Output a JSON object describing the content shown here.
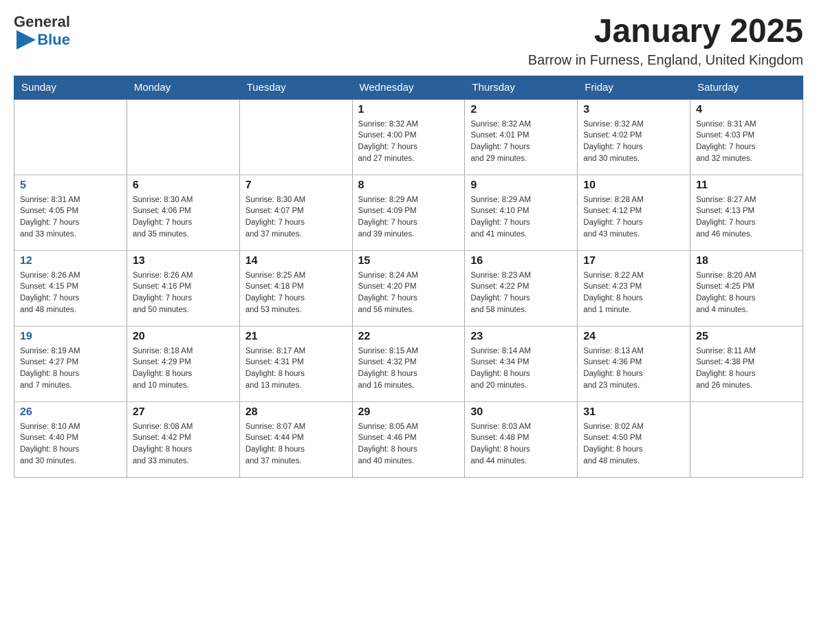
{
  "header": {
    "logo": {
      "general": "General",
      "triangle_icon": "▶",
      "blue": "Blue"
    },
    "title": "January 2025",
    "location": "Barrow in Furness, England, United Kingdom"
  },
  "days_of_week": [
    "Sunday",
    "Monday",
    "Tuesday",
    "Wednesday",
    "Thursday",
    "Friday",
    "Saturday"
  ],
  "weeks": [
    [
      {
        "day": "",
        "info": ""
      },
      {
        "day": "",
        "info": ""
      },
      {
        "day": "",
        "info": ""
      },
      {
        "day": "1",
        "info": "Sunrise: 8:32 AM\nSunset: 4:00 PM\nDaylight: 7 hours\nand 27 minutes."
      },
      {
        "day": "2",
        "info": "Sunrise: 8:32 AM\nSunset: 4:01 PM\nDaylight: 7 hours\nand 29 minutes."
      },
      {
        "day": "3",
        "info": "Sunrise: 8:32 AM\nSunset: 4:02 PM\nDaylight: 7 hours\nand 30 minutes."
      },
      {
        "day": "4",
        "info": "Sunrise: 8:31 AM\nSunset: 4:03 PM\nDaylight: 7 hours\nand 32 minutes."
      }
    ],
    [
      {
        "day": "5",
        "info": "Sunrise: 8:31 AM\nSunset: 4:05 PM\nDaylight: 7 hours\nand 33 minutes."
      },
      {
        "day": "6",
        "info": "Sunrise: 8:30 AM\nSunset: 4:06 PM\nDaylight: 7 hours\nand 35 minutes."
      },
      {
        "day": "7",
        "info": "Sunrise: 8:30 AM\nSunset: 4:07 PM\nDaylight: 7 hours\nand 37 minutes."
      },
      {
        "day": "8",
        "info": "Sunrise: 8:29 AM\nSunset: 4:09 PM\nDaylight: 7 hours\nand 39 minutes."
      },
      {
        "day": "9",
        "info": "Sunrise: 8:29 AM\nSunset: 4:10 PM\nDaylight: 7 hours\nand 41 minutes."
      },
      {
        "day": "10",
        "info": "Sunrise: 8:28 AM\nSunset: 4:12 PM\nDaylight: 7 hours\nand 43 minutes."
      },
      {
        "day": "11",
        "info": "Sunrise: 8:27 AM\nSunset: 4:13 PM\nDaylight: 7 hours\nand 46 minutes."
      }
    ],
    [
      {
        "day": "12",
        "info": "Sunrise: 8:26 AM\nSunset: 4:15 PM\nDaylight: 7 hours\nand 48 minutes."
      },
      {
        "day": "13",
        "info": "Sunrise: 8:26 AM\nSunset: 4:16 PM\nDaylight: 7 hours\nand 50 minutes."
      },
      {
        "day": "14",
        "info": "Sunrise: 8:25 AM\nSunset: 4:18 PM\nDaylight: 7 hours\nand 53 minutes."
      },
      {
        "day": "15",
        "info": "Sunrise: 8:24 AM\nSunset: 4:20 PM\nDaylight: 7 hours\nand 56 minutes."
      },
      {
        "day": "16",
        "info": "Sunrise: 8:23 AM\nSunset: 4:22 PM\nDaylight: 7 hours\nand 58 minutes."
      },
      {
        "day": "17",
        "info": "Sunrise: 8:22 AM\nSunset: 4:23 PM\nDaylight: 8 hours\nand 1 minute."
      },
      {
        "day": "18",
        "info": "Sunrise: 8:20 AM\nSunset: 4:25 PM\nDaylight: 8 hours\nand 4 minutes."
      }
    ],
    [
      {
        "day": "19",
        "info": "Sunrise: 8:19 AM\nSunset: 4:27 PM\nDaylight: 8 hours\nand 7 minutes."
      },
      {
        "day": "20",
        "info": "Sunrise: 8:18 AM\nSunset: 4:29 PM\nDaylight: 8 hours\nand 10 minutes."
      },
      {
        "day": "21",
        "info": "Sunrise: 8:17 AM\nSunset: 4:31 PM\nDaylight: 8 hours\nand 13 minutes."
      },
      {
        "day": "22",
        "info": "Sunrise: 8:15 AM\nSunset: 4:32 PM\nDaylight: 8 hours\nand 16 minutes."
      },
      {
        "day": "23",
        "info": "Sunrise: 8:14 AM\nSunset: 4:34 PM\nDaylight: 8 hours\nand 20 minutes."
      },
      {
        "day": "24",
        "info": "Sunrise: 8:13 AM\nSunset: 4:36 PM\nDaylight: 8 hours\nand 23 minutes."
      },
      {
        "day": "25",
        "info": "Sunrise: 8:11 AM\nSunset: 4:38 PM\nDaylight: 8 hours\nand 26 minutes."
      }
    ],
    [
      {
        "day": "26",
        "info": "Sunrise: 8:10 AM\nSunset: 4:40 PM\nDaylight: 8 hours\nand 30 minutes."
      },
      {
        "day": "27",
        "info": "Sunrise: 8:08 AM\nSunset: 4:42 PM\nDaylight: 8 hours\nand 33 minutes."
      },
      {
        "day": "28",
        "info": "Sunrise: 8:07 AM\nSunset: 4:44 PM\nDaylight: 8 hours\nand 37 minutes."
      },
      {
        "day": "29",
        "info": "Sunrise: 8:05 AM\nSunset: 4:46 PM\nDaylight: 8 hours\nand 40 minutes."
      },
      {
        "day": "30",
        "info": "Sunrise: 8:03 AM\nSunset: 4:48 PM\nDaylight: 8 hours\nand 44 minutes."
      },
      {
        "day": "31",
        "info": "Sunrise: 8:02 AM\nSunset: 4:50 PM\nDaylight: 8 hours\nand 48 minutes."
      },
      {
        "day": "",
        "info": ""
      }
    ]
  ]
}
